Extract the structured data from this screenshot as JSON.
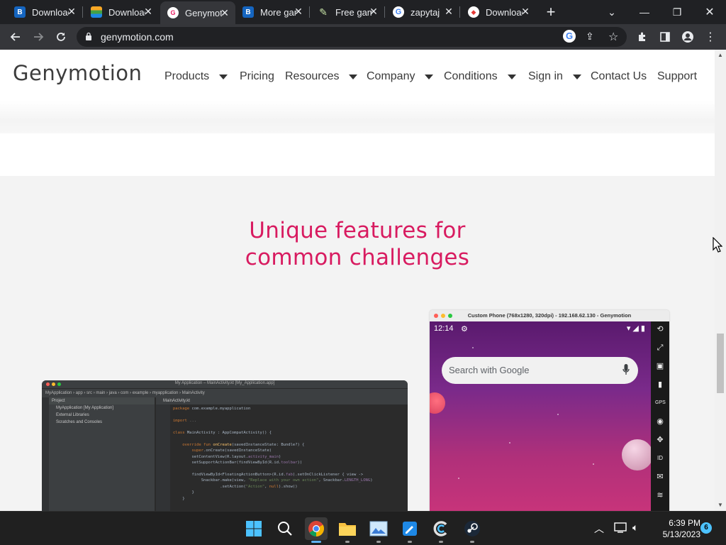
{
  "browser": {
    "tabs": [
      {
        "title": "Download",
        "icon": "bluestacks-icon",
        "color": "#1a73e8",
        "active": false
      },
      {
        "title": "Download",
        "icon": "bluestacks-layers-icon",
        "color": "#34a853",
        "active": false
      },
      {
        "title": "Genymotion",
        "icon": "genymotion-icon",
        "color": "#e91e63",
        "active": true
      },
      {
        "title": "More games",
        "icon": "bluestacks-icon",
        "color": "#1a73e8",
        "active": false
      },
      {
        "title": "Free games",
        "icon": "feather-icon",
        "color": "#8bc34a",
        "active": false
      },
      {
        "title": "zapytaj",
        "icon": "google-icon",
        "color": "#4285f4",
        "active": false
      },
      {
        "title": "Download",
        "icon": "ruby-icon",
        "color": "#ff7043",
        "active": false
      }
    ],
    "url": "genymotion.com"
  },
  "site": {
    "logo": "Genymotion",
    "nav": [
      {
        "label": "Products",
        "dropdown": true
      },
      {
        "label": "Pricing",
        "dropdown": false
      },
      {
        "label": "Resources",
        "dropdown": true
      },
      {
        "label": "Company",
        "dropdown": true
      },
      {
        "label": "Conditions",
        "dropdown": true
      },
      {
        "label": "Sign in",
        "dropdown": true
      },
      {
        "label": "Contact Us",
        "dropdown": false
      },
      {
        "label": "Support",
        "dropdown": false
      }
    ],
    "headline_line1": "Unique features for",
    "headline_line2": "common challenges",
    "accent_color": "#d81b60"
  },
  "ide": {
    "window_title": "My Application – MainActivity.kt [My_Application.app]",
    "breadcrumb": "MyApplication › app › src › main › java › com › example › myapplication › MainActivity",
    "project_label": "Project",
    "project_rows": [
      "MyApplication [My Application]",
      "External Libraries",
      "Scratches and Consoles"
    ],
    "file_tab": "MainActivity.kt"
  },
  "phone": {
    "window_title": "Custom Phone (768x1280, 320dpi) - 192.168.62.130 - Genymotion",
    "time": "12:14",
    "search_placeholder": "Search with Google"
  },
  "taskbar": {
    "apps": [
      "windows-start-icon",
      "search-icon",
      "chrome-icon",
      "file-explorer-icon",
      "photos-icon",
      "paint-icon",
      "ccleaner-icon",
      "steam-icon"
    ],
    "time": "6:39 PM",
    "date": "5/13/2023",
    "notification_count": "6"
  }
}
